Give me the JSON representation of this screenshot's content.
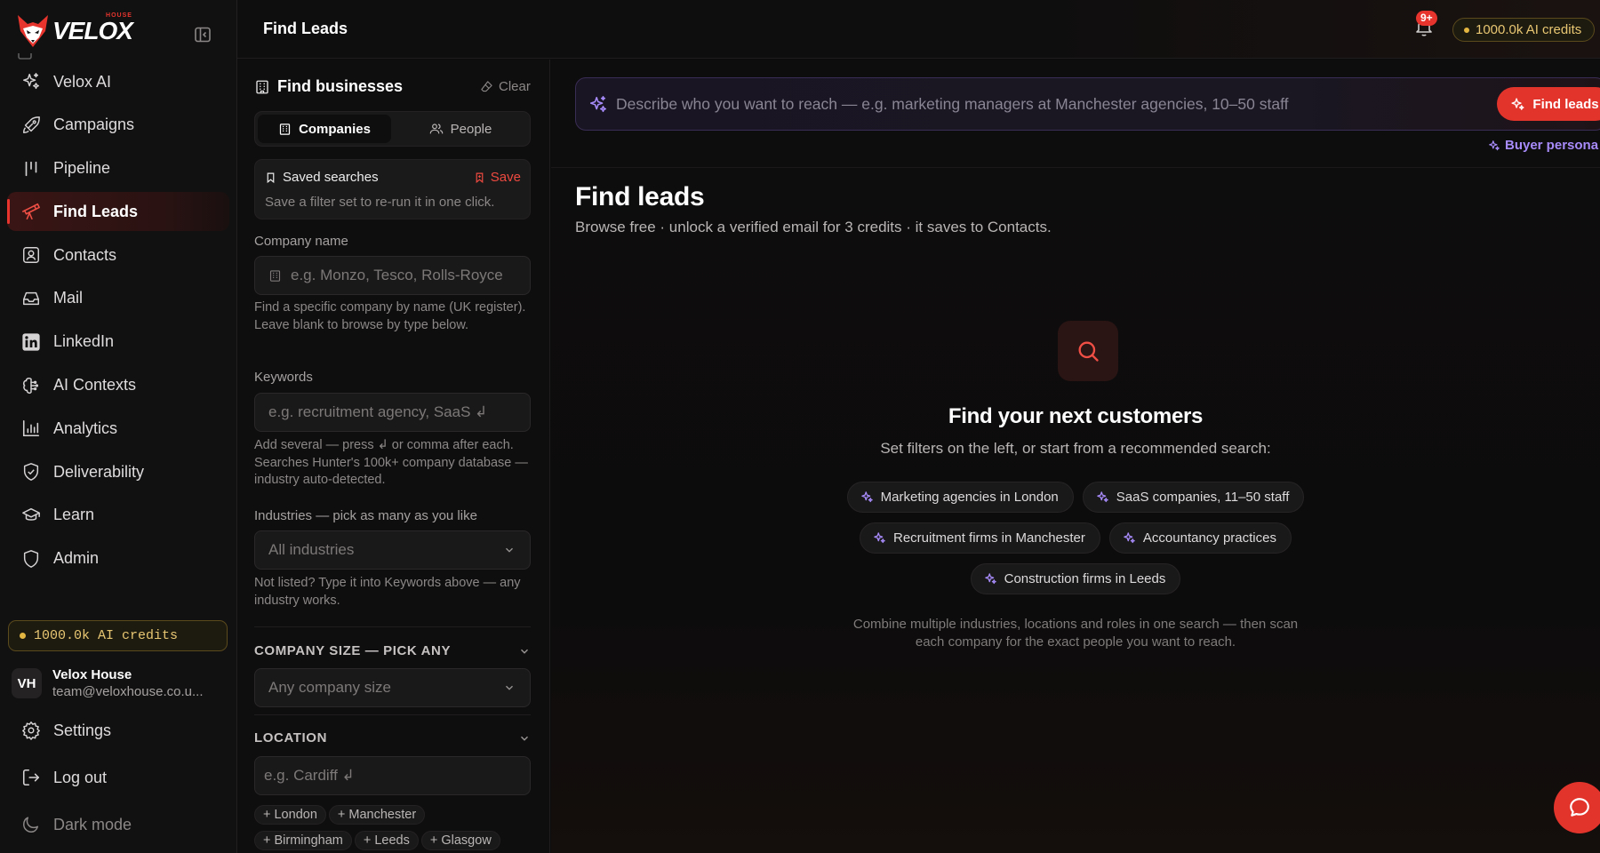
{
  "brand": {
    "name": "VELOX",
    "sub": "HOUSE",
    "accent": "#e7352e"
  },
  "sidebar": {
    "items": [
      {
        "label": "Velox AI",
        "icon": "sparkles-icon"
      },
      {
        "label": "Campaigns",
        "icon": "rocket-icon"
      },
      {
        "label": "Pipeline",
        "icon": "kanban-icon"
      },
      {
        "label": "Find Leads",
        "icon": "telescope-icon",
        "active": true
      },
      {
        "label": "Contacts",
        "icon": "contact-card-icon"
      },
      {
        "label": "Mail",
        "icon": "inbox-icon"
      },
      {
        "label": "LinkedIn",
        "icon": "linkedin-icon"
      },
      {
        "label": "AI Contexts",
        "icon": "brain-icon"
      },
      {
        "label": "Analytics",
        "icon": "bar-chart-icon"
      },
      {
        "label": "Deliverability",
        "icon": "shield-check-icon"
      },
      {
        "label": "Learn",
        "icon": "graduation-cap-icon"
      },
      {
        "label": "Admin",
        "icon": "shield-icon"
      }
    ],
    "credits": "1000.0k AI credits",
    "user": {
      "initials": "VH",
      "name": "Velox House",
      "email": "team@veloxhouse.co.u..."
    },
    "settings": "Settings",
    "logout": "Log out",
    "dark_mode": "Dark mode"
  },
  "topbar": {
    "title": "Find Leads",
    "notifications_badge": "9+",
    "credits": "1000.0k AI credits"
  },
  "filters": {
    "title": "Find businesses",
    "clear": "Clear",
    "tabs": [
      "Companies",
      "People"
    ],
    "saved": {
      "title": "Saved searches",
      "save": "Save",
      "hint": "Save a filter set to re-run it in one click."
    },
    "company_name": {
      "label": "Company name",
      "placeholder": "e.g. Monzo, Tesco, Rolls-Royce",
      "help": "Find a specific company by name (UK register). Leave blank to browse by type below."
    },
    "keywords": {
      "label": "Keywords",
      "placeholder": "e.g. recruitment agency, SaaS ↲",
      "help": "Add several — press ↲ or comma after each. Searches Hunter's 100k+ company database — industry auto-detected."
    },
    "industries": {
      "label": "Industries — pick as many as you like",
      "value": "All industries",
      "help": "Not listed? Type it into Keywords above — any industry works."
    },
    "company_size": {
      "heading": "COMPANY SIZE — PICK ANY",
      "value": "Any company size"
    },
    "location": {
      "heading": "LOCATION",
      "placeholder": "e.g. Cardiff ↲",
      "chips": [
        "+ London",
        "+ Manchester",
        "+ Birmingham",
        "+ Leeds",
        "+ Glasgow"
      ]
    }
  },
  "main": {
    "ai_placeholder": "Describe who you want to reach — e.g. marketing managers at Manchester agencies, 10–50 staff",
    "find_button": "Find leads",
    "persona_link": "Buyer persona",
    "title": "Find leads",
    "subtitle": "Browse free · unlock a verified email for 3 credits · it saves to Contacts.",
    "empty": {
      "title": "Find your next customers",
      "subtitle": "Set filters on the left, or start from a recommended search:",
      "suggestions": [
        "Marketing agencies in London",
        "SaaS companies, 11–50 staff",
        "Recruitment firms in Manchester",
        "Accountancy practices",
        "Construction firms in Leeds"
      ],
      "footer": "Combine multiple industries, locations and roles in one search — then scan each company for the exact people you want to reach."
    }
  },
  "colors": {
    "accent": "#e3342c",
    "gold": "#e8c772",
    "violet": "#a78bfa"
  }
}
